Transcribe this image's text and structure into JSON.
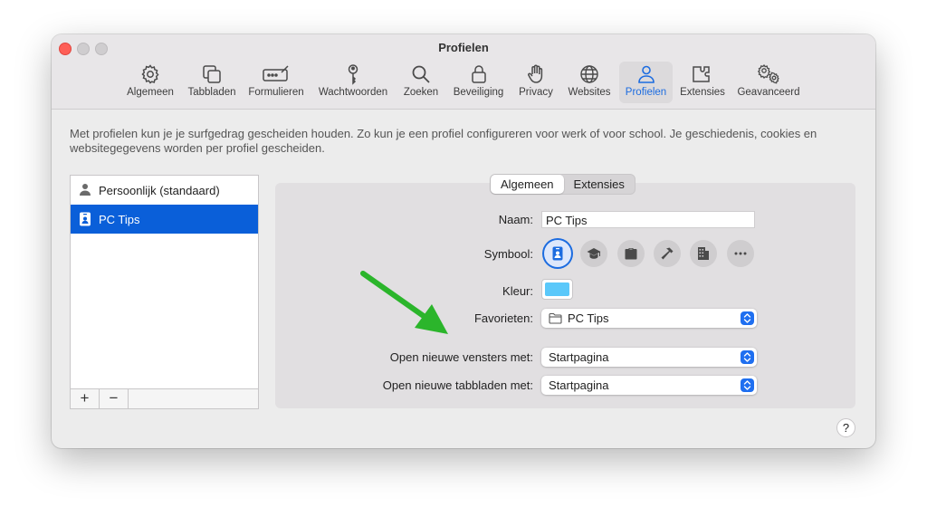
{
  "window": {
    "title": "Profielen"
  },
  "toolbar": {
    "items": [
      {
        "label": "Algemeen",
        "icon": "gear-icon"
      },
      {
        "label": "Tabbladen",
        "icon": "tabs-icon"
      },
      {
        "label": "Formulieren",
        "icon": "form-icon"
      },
      {
        "label": "Wachtwoorden",
        "icon": "key-icon"
      },
      {
        "label": "Zoeken",
        "icon": "search-icon"
      },
      {
        "label": "Beveiliging",
        "icon": "lock-icon"
      },
      {
        "label": "Privacy",
        "icon": "hand-icon"
      },
      {
        "label": "Websites",
        "icon": "globe-icon"
      },
      {
        "label": "Profielen",
        "icon": "person-icon"
      },
      {
        "label": "Extensies",
        "icon": "puzzle-icon"
      },
      {
        "label": "Geavanceerd",
        "icon": "gears-icon"
      }
    ],
    "active": "Profielen"
  },
  "description": "Met profielen kun je je surfgedrag gescheiden houden. Zo kun je een profiel configureren voor werk of voor school. Je geschiedenis, cookies en websitegegevens worden per profiel gescheiden.",
  "profiles": {
    "items": [
      {
        "label": "Persoonlijk (standaard)",
        "icon": "person-icon"
      },
      {
        "label": "PC Tips",
        "icon": "id-badge-icon"
      }
    ],
    "selected": "PC Tips",
    "add_label": "+",
    "remove_label": "−"
  },
  "tabs": {
    "items": [
      "Algemeen",
      "Extensies"
    ],
    "active": "Algemeen"
  },
  "form": {
    "name_label": "Naam:",
    "name_value": "PC Tips",
    "symbol_label": "Symbool:",
    "symbols": [
      "id-badge-icon",
      "graduation-cap-icon",
      "briefcase-icon",
      "hammer-icon",
      "building-icon",
      "more-icon"
    ],
    "color_label": "Kleur:",
    "color_value": "#5ac8fa",
    "favorites_label": "Favorieten:",
    "favorites_value": "PC Tips",
    "new_windows_label": "Open nieuwe vensters met:",
    "new_windows_value": "Startpagina",
    "new_tabs_label": "Open nieuwe tabbladen met:",
    "new_tabs_value": "Startpagina"
  },
  "help_label": "?",
  "colors": {
    "accent": "#1c6ce0",
    "selection": "#0a5fd9",
    "annotation_arrow": "#2bb52b"
  }
}
